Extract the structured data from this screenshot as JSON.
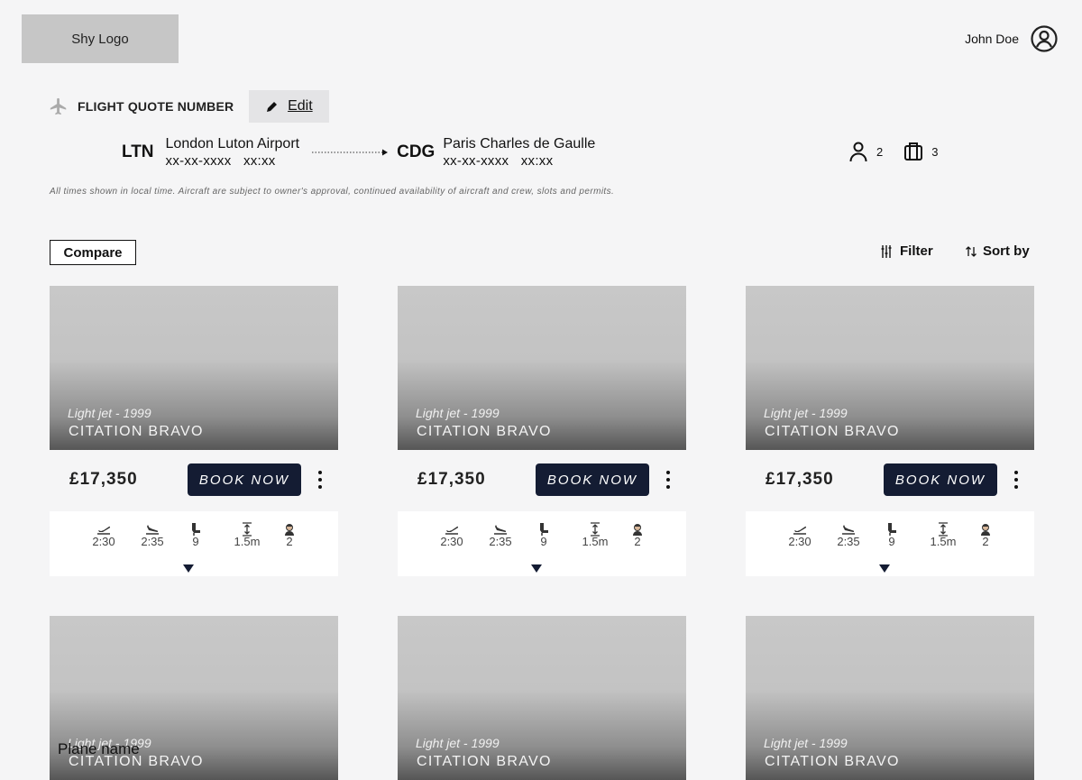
{
  "header": {
    "logo_text": "Shy Logo",
    "user_name": "John Doe",
    "user_icon": "user-circle-icon"
  },
  "quote": {
    "label": "FLIGHT QUOTE NUMBER",
    "edit_label": "Edit"
  },
  "route": {
    "origin_code": "LTN",
    "origin_name": "London Luton Airport",
    "origin_date": "xx-xx-xxxx",
    "origin_time": "xx:xx",
    "dest_code": "CDG",
    "dest_name": "Paris Charles de Gaulle",
    "dest_date": "xx-xx-xxxx",
    "dest_time": "xx:xx",
    "passengers": "2",
    "luggage": "3"
  },
  "disclaimer": "All times shown in local time. Aircraft are subject to owner's approval, continued availability of aircraft and crew, slots and permits.",
  "toolbar": {
    "compare_label": "Compare",
    "filter_label": "Filter",
    "sort_label": "Sort by"
  },
  "cards": [
    {
      "category": "Light jet - 1999",
      "name": "CITATION BRAVO",
      "price": "£17,350",
      "book_label": "BOOK NOW",
      "outbound": "2:30",
      "return": "2:35",
      "seats": "9",
      "cabin_height": "1.5m",
      "crew": "2"
    },
    {
      "category": "Light jet - 1999",
      "name": "CITATION BRAVO",
      "price": "£17,350",
      "book_label": "BOOK NOW",
      "outbound": "2:30",
      "return": "2:35",
      "seats": "9",
      "cabin_height": "1.5m",
      "crew": "2"
    },
    {
      "category": "Light jet - 1999",
      "name": "CITATION BRAVO",
      "price": "£17,350",
      "book_label": "BOOK NOW",
      "outbound": "2:30",
      "return": "2:35",
      "seats": "9",
      "cabin_height": "1.5m",
      "crew": "2"
    },
    {
      "category": "Light jet - 1999",
      "name": "CITATION BRAVO"
    },
    {
      "category": "Light jet - 1999",
      "name": "CITATION BRAVO"
    },
    {
      "category": "Light jet - 1999",
      "name": "CITATION BRAVO"
    }
  ],
  "overlay_label": "Plane name",
  "colors": {
    "book_button": "#141c33",
    "background": "#f5f5f6",
    "logo_box": "#c6c6c6"
  }
}
